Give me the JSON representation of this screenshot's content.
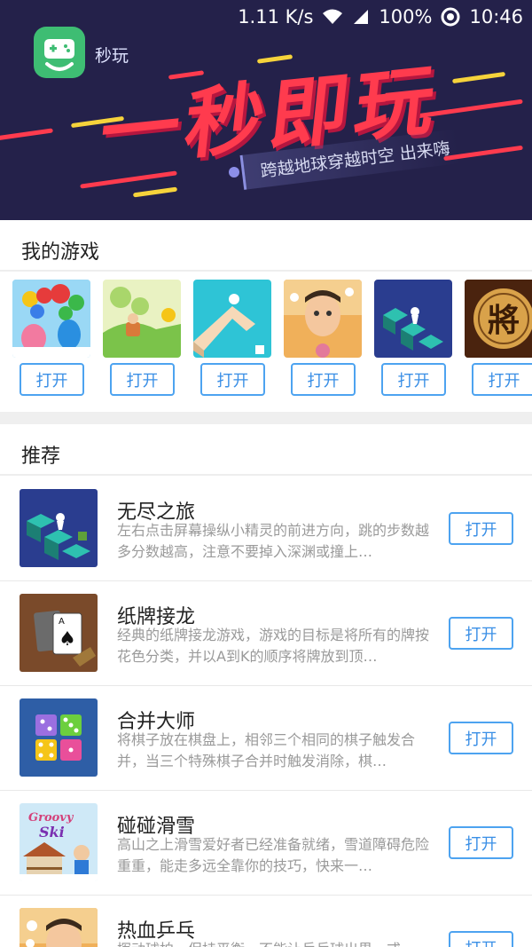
{
  "status_bar": {
    "speed": "1.11 K/s",
    "battery": "100%",
    "time": "10:46",
    "icons": [
      "wifi-icon",
      "signal-icon",
      "alarm-icon"
    ]
  },
  "app": {
    "name": "秒玩",
    "logo_icon": "gamepad-icon",
    "brand_color": "#3ebd73"
  },
  "banner": {
    "slogan": "一秒即玩",
    "tagline": "跨越地球穿越时空 出来嗨"
  },
  "my_games": {
    "title": "我的游戏",
    "open_label": "打开",
    "games": [
      {
        "icon": "bubble-shooter-icon"
      },
      {
        "icon": "island-adventure-icon"
      },
      {
        "icon": "maze-runner-icon"
      },
      {
        "icon": "ping-pong-cartoon-icon"
      },
      {
        "icon": "endless-journey-icon"
      },
      {
        "icon": "chinese-chess-icon",
        "glyph": "將"
      }
    ]
  },
  "recommended": {
    "title": "推荐",
    "items": [
      {
        "title": "无尽之旅",
        "desc": "左右点击屏幕操纵小精灵的前进方向，跳的步数越多分数越高，注意不要掉入深渊或撞上…",
        "button": "打开",
        "icon": "endless-journey-icon"
      },
      {
        "title": "纸牌接龙",
        "desc": "经典的纸牌接龙游戏，游戏的目标是将所有的牌按花色分类，并以A到K的顺序将牌放到顶…",
        "button": "打开",
        "icon": "solitaire-card-icon",
        "card_rank": "A",
        "card_suit": "♠"
      },
      {
        "title": "合并大师",
        "desc": "将棋子放在棋盘上，相邻三个相同的棋子触发合并，当三个特殊棋子合并时触发消除，棋…",
        "button": "打开",
        "icon": "dice-merge-icon"
      },
      {
        "title": "碰碰滑雪",
        "desc": "高山之上滑雪爱好者已经准备就绪，雪道障碍危险重重，能走多远全靠你的技巧，快来一…",
        "button": "打开",
        "icon": "groovy-ski-icon",
        "logo_text": [
          "Groovy",
          "Ski"
        ]
      },
      {
        "title": "热血乒乓",
        "desc": "挥动球拍，保持平衡，不能让乒乓球出界，或…",
        "button": "打开",
        "icon": "ping-pong-cartoon-icon"
      }
    ]
  },
  "colors": {
    "banner_bg": "#24214a",
    "slogan": "#ff3b4e",
    "button_border": "#4da3f0",
    "button_text": "#3a8fe6"
  }
}
